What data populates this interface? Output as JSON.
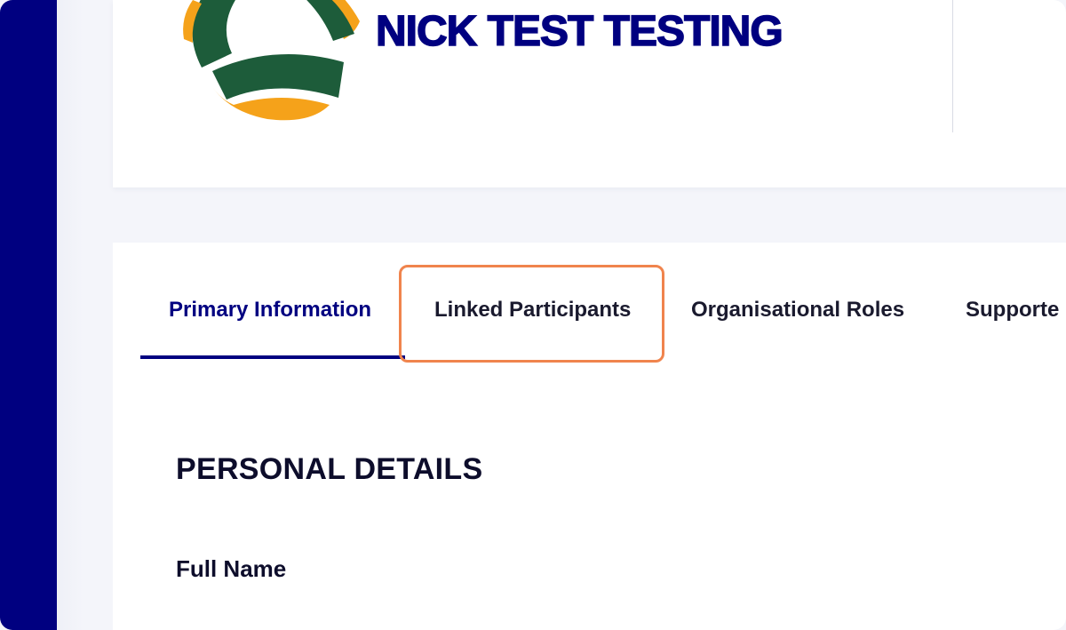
{
  "header": {
    "org_name": "NICK TEST TESTING",
    "logo": "football-federation-logo"
  },
  "tabs": [
    {
      "label": "Primary Information",
      "active": true
    },
    {
      "label": "Linked Participants",
      "active": false,
      "highlighted": true
    },
    {
      "label": "Organisational Roles",
      "active": false
    },
    {
      "label": "Supporte",
      "active": false
    }
  ],
  "section": {
    "title": "PERSONAL DETAILS",
    "fields": [
      {
        "label": "Full Name"
      }
    ]
  },
  "colors": {
    "brand_navy": "#000080",
    "logo_green": "#1d5c3a",
    "logo_gold": "#f5a21a",
    "highlight": "#f0844d"
  }
}
